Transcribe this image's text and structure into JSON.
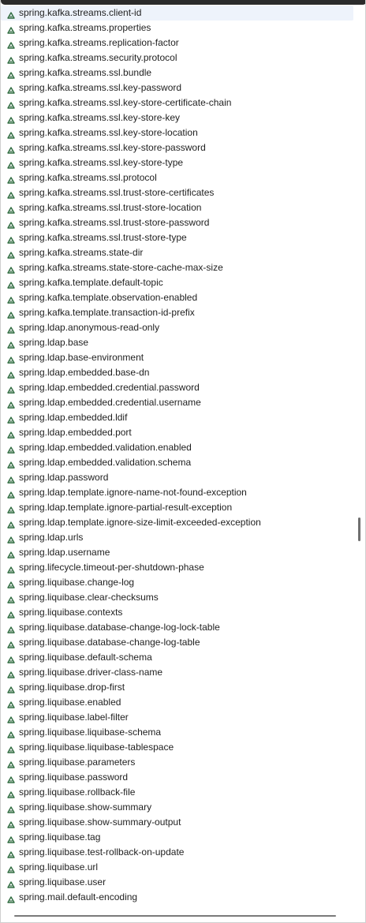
{
  "list": {
    "items": [
      "spring.kafka.streams.client-id",
      "spring.kafka.streams.properties",
      "spring.kafka.streams.replication-factor",
      "spring.kafka.streams.security.protocol",
      "spring.kafka.streams.ssl.bundle",
      "spring.kafka.streams.ssl.key-password",
      "spring.kafka.streams.ssl.key-store-certificate-chain",
      "spring.kafka.streams.ssl.key-store-key",
      "spring.kafka.streams.ssl.key-store-location",
      "spring.kafka.streams.ssl.key-store-password",
      "spring.kafka.streams.ssl.key-store-type",
      "spring.kafka.streams.ssl.protocol",
      "spring.kafka.streams.ssl.trust-store-certificates",
      "spring.kafka.streams.ssl.trust-store-location",
      "spring.kafka.streams.ssl.trust-store-password",
      "spring.kafka.streams.ssl.trust-store-type",
      "spring.kafka.streams.state-dir",
      "spring.kafka.streams.state-store-cache-max-size",
      "spring.kafka.template.default-topic",
      "spring.kafka.template.observation-enabled",
      "spring.kafka.template.transaction-id-prefix",
      "spring.ldap.anonymous-read-only",
      "spring.ldap.base",
      "spring.ldap.base-environment",
      "spring.ldap.embedded.base-dn",
      "spring.ldap.embedded.credential.password",
      "spring.ldap.embedded.credential.username",
      "spring.ldap.embedded.ldif",
      "spring.ldap.embedded.port",
      "spring.ldap.embedded.validation.enabled",
      "spring.ldap.embedded.validation.schema",
      "spring.ldap.password",
      "spring.ldap.template.ignore-name-not-found-exception",
      "spring.ldap.template.ignore-partial-result-exception",
      "spring.ldap.template.ignore-size-limit-exceeded-exception",
      "spring.ldap.urls",
      "spring.ldap.username",
      "spring.lifecycle.timeout-per-shutdown-phase",
      "spring.liquibase.change-log",
      "spring.liquibase.clear-checksums",
      "spring.liquibase.contexts",
      "spring.liquibase.database-change-log-lock-table",
      "spring.liquibase.database-change-log-table",
      "spring.liquibase.default-schema",
      "spring.liquibase.driver-class-name",
      "spring.liquibase.drop-first",
      "spring.liquibase.enabled",
      "spring.liquibase.label-filter",
      "spring.liquibase.liquibase-schema",
      "spring.liquibase.liquibase-tablespace",
      "spring.liquibase.parameters",
      "spring.liquibase.password",
      "spring.liquibase.rollback-file",
      "spring.liquibase.show-summary",
      "spring.liquibase.show-summary-output",
      "spring.liquibase.tag",
      "spring.liquibase.test-rollback-on-update",
      "spring.liquibase.url",
      "spring.liquibase.user",
      "spring.mail.default-encoding"
    ],
    "selected_index": 0,
    "item_icon": "property-icon",
    "icon_color": "#2e6b3f",
    "selection_color": "#eef3fb"
  }
}
